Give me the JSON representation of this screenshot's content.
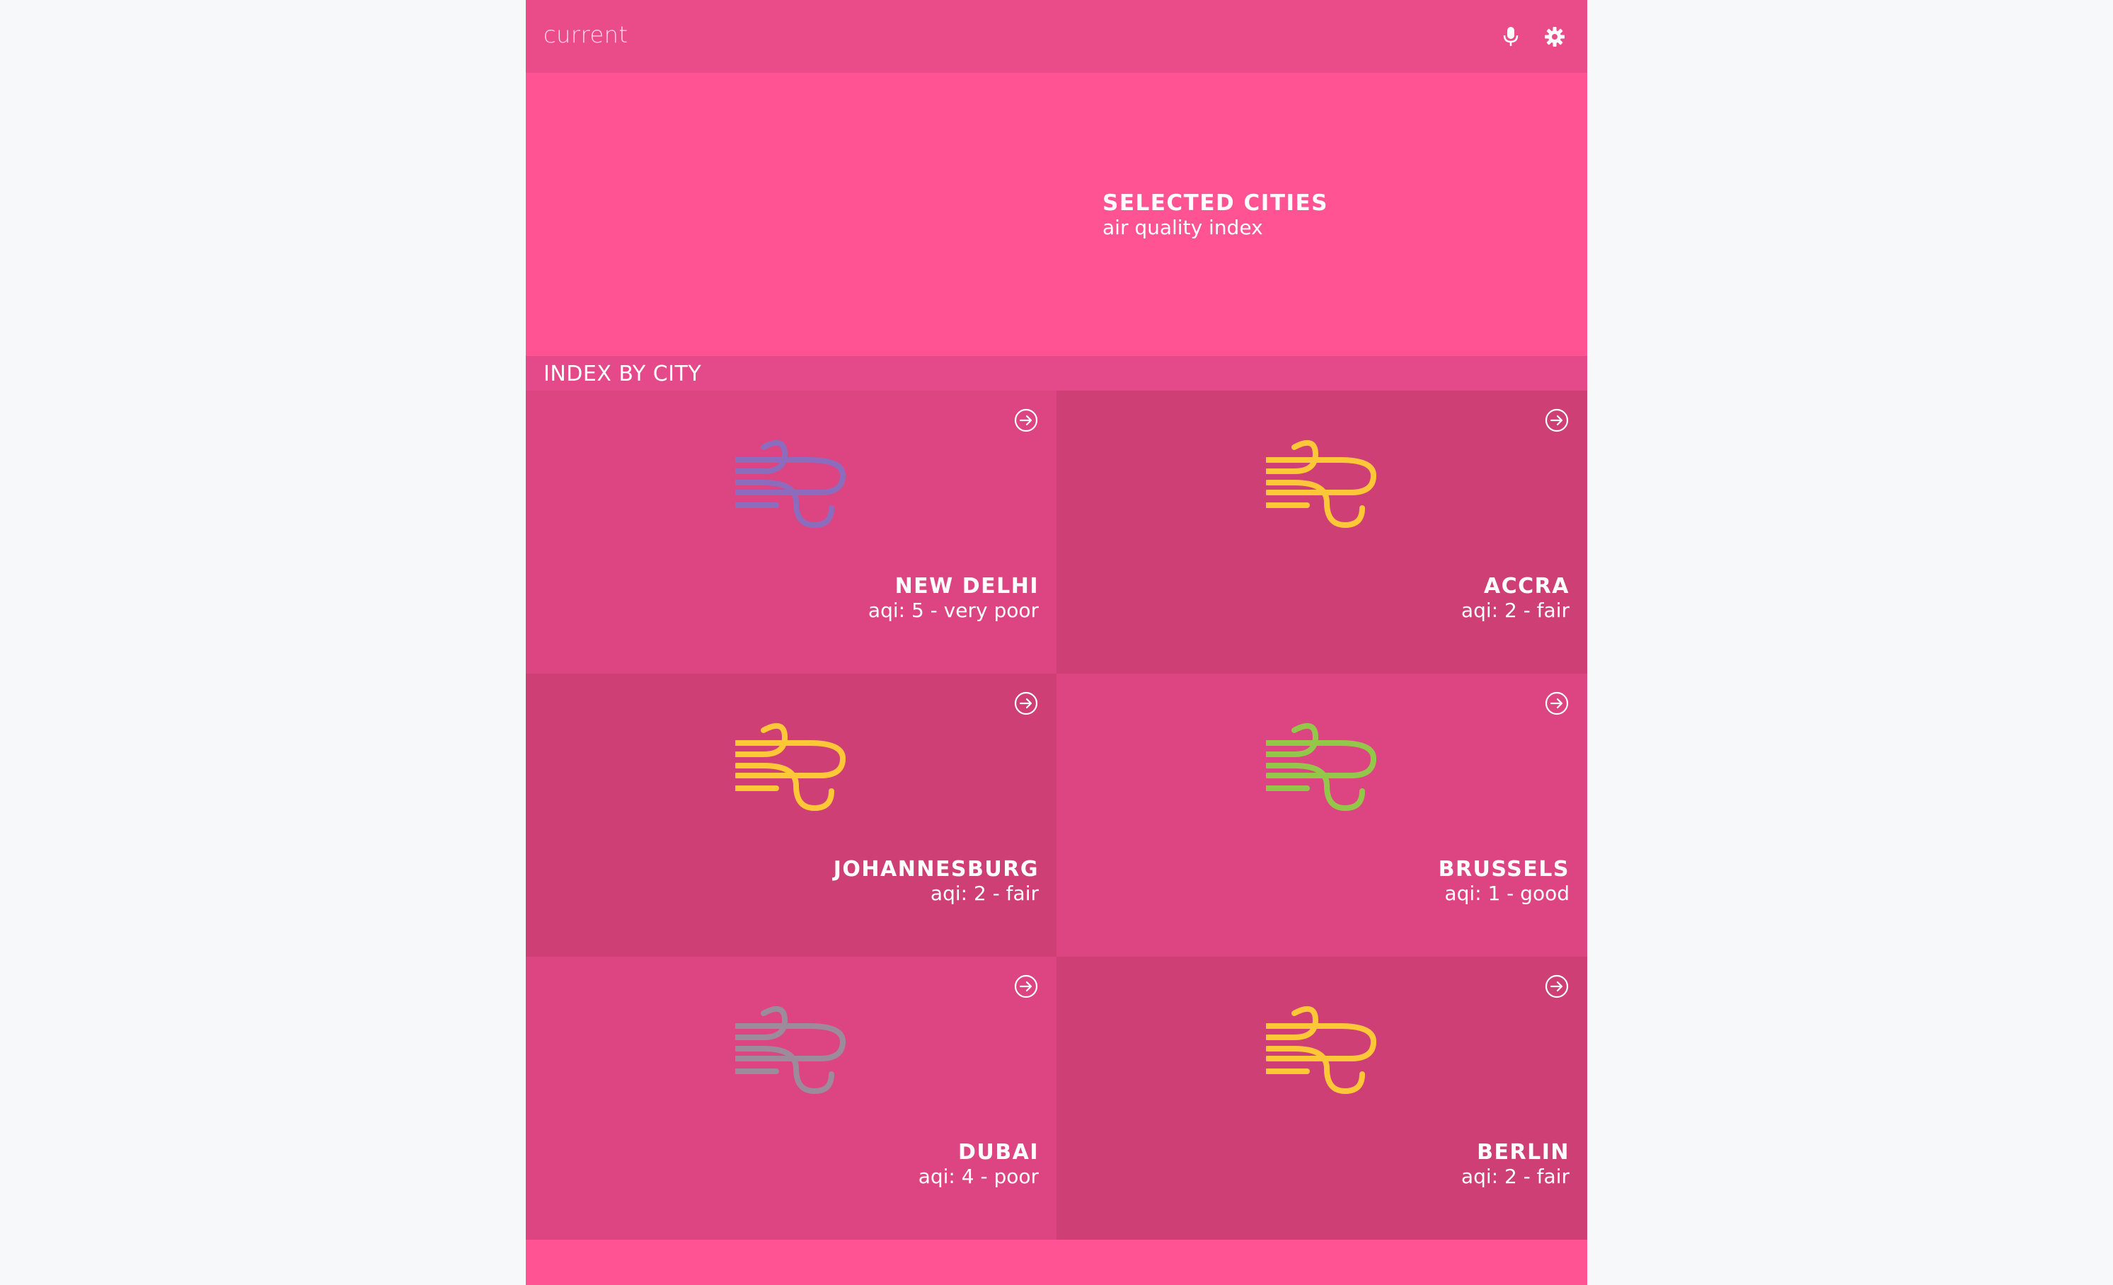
{
  "topbar": {
    "title": "current",
    "mic_icon": "microphone-icon",
    "settings_icon": "gear-icon"
  },
  "hero": {
    "title": "SELECTED CITIES",
    "subtitle": "air quality index"
  },
  "section": {
    "title": "INDEX BY CITY"
  },
  "cities": [
    {
      "name": "NEW DELHI",
      "aqi_text": "aqi: 5 - very poor",
      "aqi": 5,
      "icon": "wind-icon",
      "icon_color": "#8e6cbd"
    },
    {
      "name": "ACCRA",
      "aqi_text": "aqi: 2 - fair",
      "aqi": 2,
      "icon": "wind-icon",
      "icon_color": "#fdc738"
    },
    {
      "name": "JOHANNESBURG",
      "aqi_text": "aqi: 2 - fair",
      "aqi": 2,
      "icon": "wind-icon",
      "icon_color": "#fdc738"
    },
    {
      "name": "BRUSSELS",
      "aqi_text": "aqi: 1 - good",
      "aqi": 1,
      "icon": "wind-icon",
      "icon_color": "#92c74a"
    },
    {
      "name": "DUBAI",
      "aqi_text": "aqi: 4 - poor",
      "aqi": 4,
      "icon": "wind-icon",
      "icon_color": "#9d8a9a"
    },
    {
      "name": "BERLIN",
      "aqi_text": "aqi: 2 - fair",
      "aqi": 2,
      "icon": "wind-icon",
      "icon_color": "#fdc738"
    }
  ],
  "colors": {
    "topbar": "#ea4c8a",
    "hero": "#ff5394",
    "tile_light": "#dc4581",
    "tile_dark": "#cd3f75"
  }
}
